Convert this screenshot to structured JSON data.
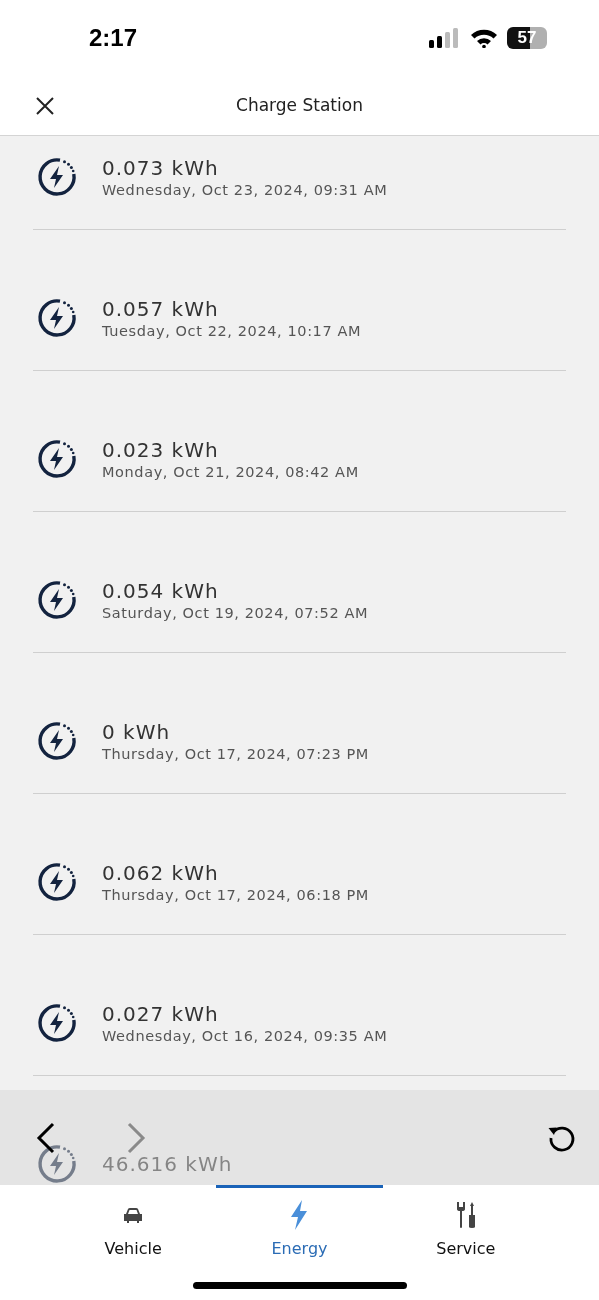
{
  "status_bar": {
    "time": "2:17",
    "battery": "57"
  },
  "header": {
    "title": "Charge Station"
  },
  "sessions": [
    {
      "energy": "0.073 kWh",
      "datetime": "Wednesday, Oct 23, 2024, 09:31 AM"
    },
    {
      "energy": "0.057 kWh",
      "datetime": "Tuesday, Oct 22, 2024, 10:17 AM"
    },
    {
      "energy": "0.023 kWh",
      "datetime": "Monday, Oct 21, 2024, 08:42 AM"
    },
    {
      "energy": "0.054 kWh",
      "datetime": "Saturday, Oct 19, 2024, 07:52 AM"
    },
    {
      "energy": "0 kWh",
      "datetime": "Thursday, Oct 17, 2024, 07:23 PM"
    },
    {
      "energy": "0.062 kWh",
      "datetime": "Thursday, Oct 17, 2024, 06:18 PM"
    },
    {
      "energy": "0.027 kWh",
      "datetime": "Wednesday, Oct 16, 2024, 09:35 AM"
    },
    {
      "energy": "46.616 kWh"
    }
  ],
  "browser_bar": {
    "back": {
      "disabled": false
    },
    "forward": {
      "disabled": true
    }
  },
  "tabs": [
    {
      "kind": "vehicle",
      "label": "Vehicle",
      "selected": false
    },
    {
      "kind": "energy",
      "label": "Energy",
      "selected": true
    },
    {
      "kind": "service",
      "label": "Service",
      "selected": false
    }
  ]
}
